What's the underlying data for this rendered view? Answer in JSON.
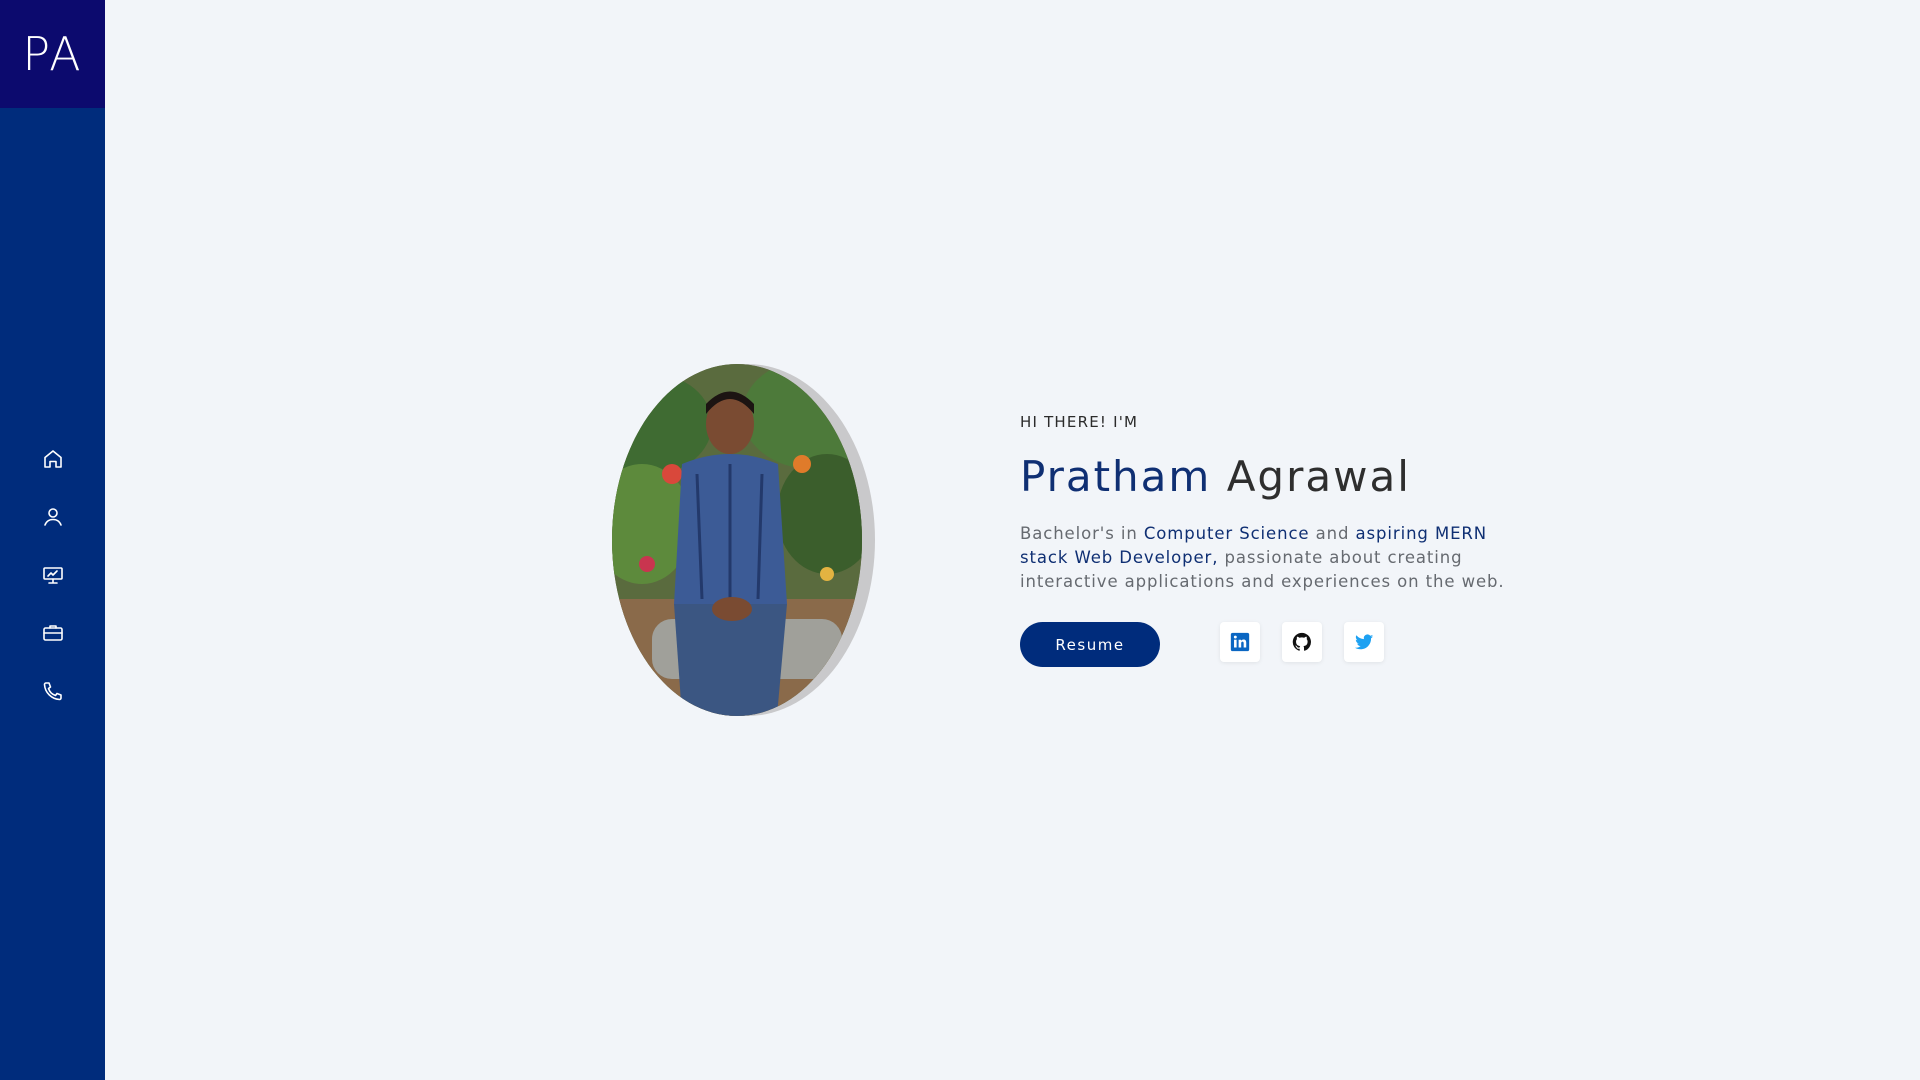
{
  "sidebar": {
    "logo": "PA",
    "nav": [
      {
        "icon": "home-icon"
      },
      {
        "icon": "user-icon"
      },
      {
        "icon": "projects-icon"
      },
      {
        "icon": "briefcase-icon"
      },
      {
        "icon": "phone-icon"
      }
    ]
  },
  "hero": {
    "greeting": "HI THERE! I'M",
    "first_name": "Pratham",
    "last_name": "Agrawal",
    "description": {
      "part1": "Bachelor's in ",
      "highlight1": "Computer Science",
      "part2": " and ",
      "highlight2": "aspiring MERN stack Web Developer,",
      "part3": " passionate about creating interactive applications and experiences on the web."
    },
    "resume_label": "Resume",
    "social": [
      {
        "icon": "linkedin-icon",
        "color": "#0a66c2"
      },
      {
        "icon": "github-icon",
        "color": "#111111"
      },
      {
        "icon": "twitter-icon",
        "color": "#1da1f2"
      }
    ]
  },
  "colors": {
    "sidebar": "#002c7c",
    "logo_bg": "#0c0a6e",
    "accent": "#0f2f73",
    "background": "#f2f5f9"
  }
}
